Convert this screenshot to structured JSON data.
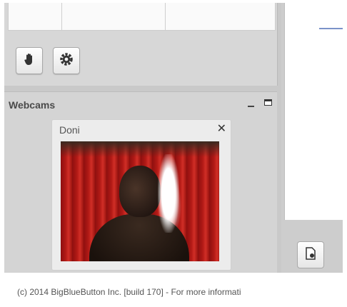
{
  "users_panel": {
    "toolbar": {
      "raise_hand_icon": "hand-icon",
      "settings_icon": "gear-icon"
    }
  },
  "webcams": {
    "title": "Webcams",
    "video": {
      "user_name": "Doni",
      "close_glyph": "✕"
    }
  },
  "presentation": {
    "upload_icon": "upload-document-icon"
  },
  "footer": {
    "text": "(c) 2014 BigBlueButton Inc. [build 170] - For more informati"
  },
  "colors": {
    "panel_bg": "#d4d4d4",
    "accent_line": "#7b93c9"
  }
}
